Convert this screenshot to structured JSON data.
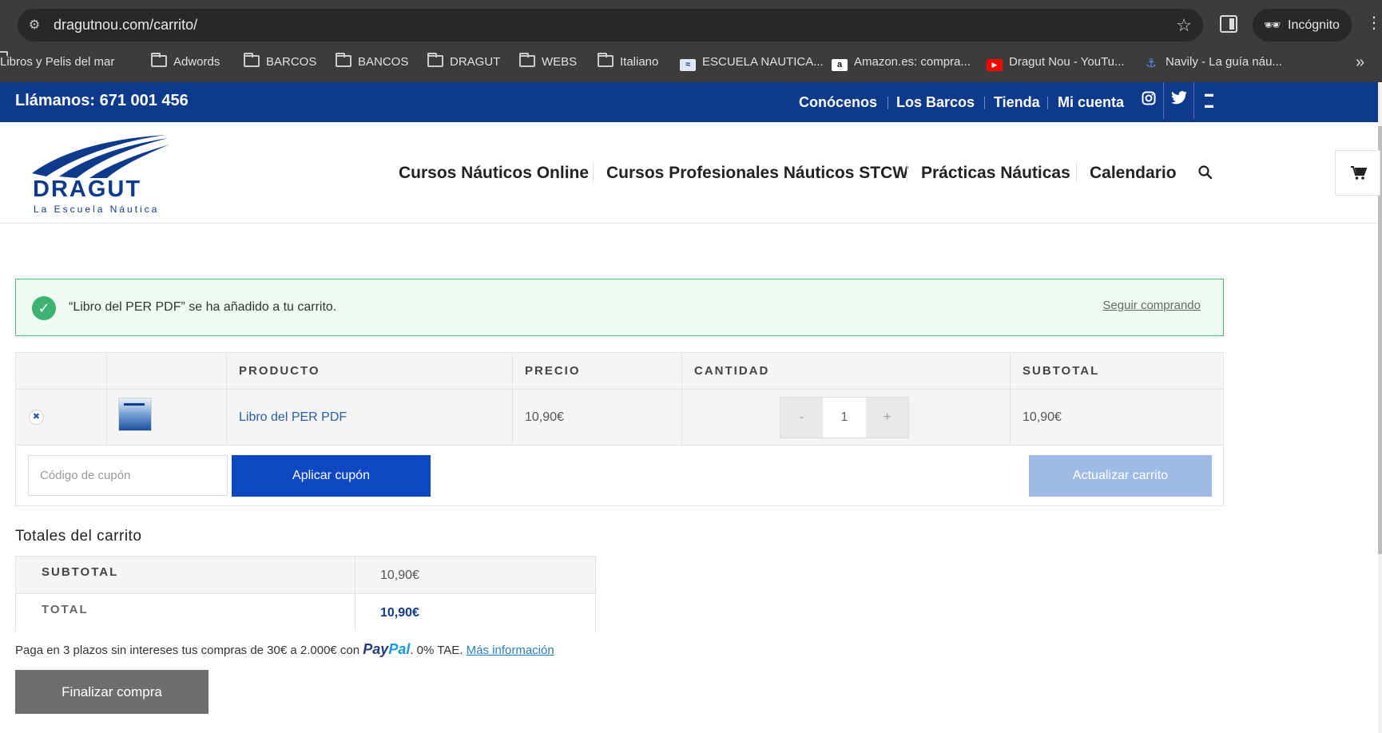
{
  "browser": {
    "url": "dragutnou.com/carrito/",
    "incognito_label": "Incógnito",
    "bookmarks": [
      {
        "label": "Libros y Pelis del mar",
        "icon": "folder-icon"
      },
      {
        "label": "Adwords",
        "icon": "folder-icon"
      },
      {
        "label": "BARCOS",
        "icon": "folder-icon"
      },
      {
        "label": "BANCOS",
        "icon": "folder-icon"
      },
      {
        "label": "DRAGUT",
        "icon": "folder-icon"
      },
      {
        "label": "WEBS",
        "icon": "folder-icon"
      },
      {
        "label": "Italiano",
        "icon": "folder-icon"
      },
      {
        "label": "ESCUELA NAUTICA...",
        "icon": "dragut-favicon"
      },
      {
        "label": "Amazon.es: compra...",
        "icon": "amazon-favicon"
      },
      {
        "label": "Dragut Nou - YouTu...",
        "icon": "youtube-favicon"
      },
      {
        "label": "Navily - La guía náu...",
        "icon": "anchor-favicon"
      }
    ]
  },
  "topbar": {
    "phone": "Llámanos: 671 001 456",
    "links": [
      "Conócenos",
      "Los Barcos",
      "Tienda",
      "Mi cuenta"
    ],
    "social": [
      "instagram-icon",
      "twitter-icon",
      "youtube-icon"
    ]
  },
  "header": {
    "logo_word": "DRAGUT",
    "logo_tagline": "La Escuela Náutica",
    "nav": [
      "Cursos Náuticos Online",
      "Cursos Profesionales Náuticos STCW",
      "Prácticas Náuticas",
      "Calendario"
    ]
  },
  "notice": {
    "message": "“Libro del PER PDF” se ha añadido a tu carrito.",
    "continue_label": "Seguir comprando"
  },
  "cart": {
    "headers": {
      "product": "PRODUCTO",
      "price": "PRECIO",
      "quantity": "CANTIDAD",
      "subtotal": "SUBTOTAL"
    },
    "items": [
      {
        "name": "Libro del PER PDF",
        "price": "10,90€",
        "quantity": "1",
        "subtotal": "10,90€"
      }
    ],
    "minus": "-",
    "plus": "+",
    "coupon_placeholder": "Código de cupón",
    "apply_label": "Aplicar cupón",
    "update_label": "Actualizar carrito"
  },
  "totals": {
    "title": "Totales del carrito",
    "subtotal_label": "SUBTOTAL",
    "subtotal_value": "10,90€",
    "total_label": "TOTAL",
    "total_value": "10,90€"
  },
  "paypal": {
    "text_before": "Paga en 3 plazos sin intereses tus compras de 30€ a 2.000€ con ",
    "logo_pay": "Pay",
    "logo_pal": "Pal",
    "text_after": ". 0% TAE. ",
    "more_info": "Más información"
  },
  "checkout_label": "Finalizar compra",
  "colors": {
    "brand_blue": "#0d3a8a",
    "apply_button": "#0d47c2",
    "update_button": "#9ebbe6",
    "checkout_button": "#6e6e6e",
    "success_green": "#3cb371"
  }
}
